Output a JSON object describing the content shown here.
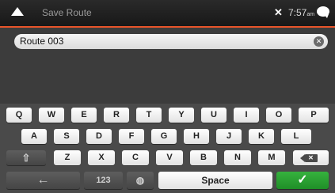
{
  "header": {
    "title": "Save Route",
    "time": "7:57",
    "time_suffix": "am",
    "icons": {
      "back": "up-arrow-icon",
      "satellite": "satellite-icon",
      "messages": "speech-bubble-icon"
    }
  },
  "input": {
    "value": "Route 003",
    "clear_icon": "clear-icon"
  },
  "keyboard": {
    "row1": [
      "Q",
      "W",
      "E",
      "R",
      "T",
      "Y",
      "U",
      "I",
      "O",
      "P"
    ],
    "row2": [
      "A",
      "S",
      "D",
      "F",
      "G",
      "H",
      "J",
      "K",
      "L"
    ],
    "row3": [
      "Z",
      "X",
      "C",
      "V",
      "B",
      "N",
      "M"
    ],
    "shift_icon": "shift-icon",
    "backspace_icon": "backspace-icon",
    "back_icon": "left-arrow-icon",
    "numbers_label": "123",
    "globe_icon": "globe-icon",
    "space_label": "Space",
    "done_icon": "checkmark-icon"
  },
  "colors": {
    "accent": "#e8542a",
    "confirm": "#2aa032"
  }
}
